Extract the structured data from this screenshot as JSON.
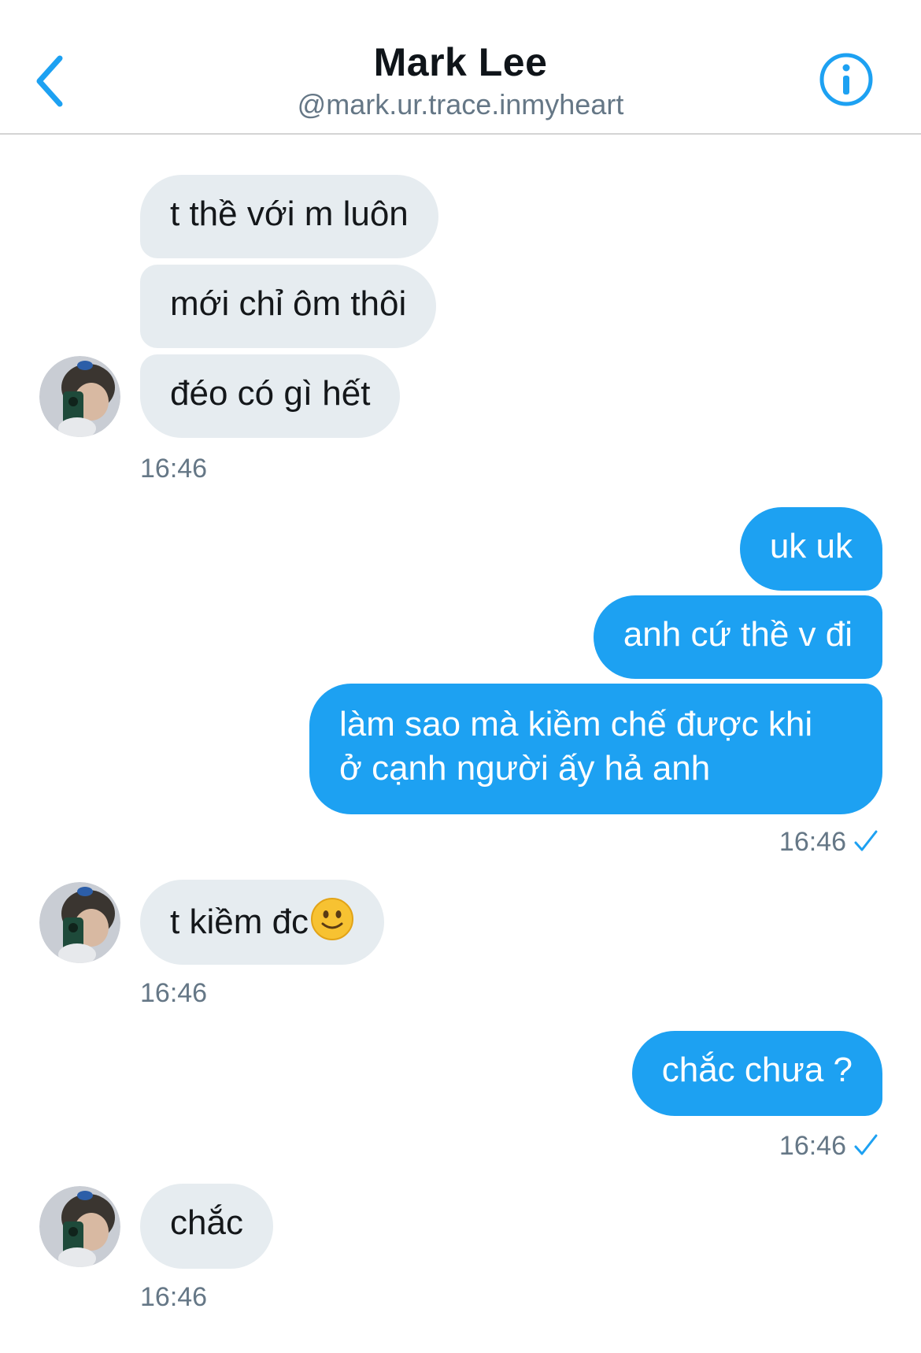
{
  "header": {
    "name": "Mark Lee",
    "handle": "@mark.ur.trace.inmyheart",
    "back_icon": "chevron-left-icon",
    "info_icon": "info-circle-icon",
    "accent_color": "#1da1f2"
  },
  "messages": [
    {
      "from": "them",
      "text": "t thề với m luôn"
    },
    {
      "from": "them",
      "text": "mới chỉ ôm thôi"
    },
    {
      "from": "them",
      "text": "đéo có gì hết",
      "time": "16:46"
    },
    {
      "from": "me",
      "text": "uk uk"
    },
    {
      "from": "me",
      "text": "anh cứ thề v đi"
    },
    {
      "from": "me",
      "line1": "làm sao mà kiềm chế được khi",
      "line2": "ở cạnh người ấy hả anh",
      "time": "16:46",
      "status_icon": "check-icon"
    },
    {
      "from": "them",
      "text": "t kiềm đc",
      "emoji": "🙂",
      "time": "16:46"
    },
    {
      "from": "me",
      "text": "chắc chưa ?",
      "time": "16:46",
      "status_icon": "check-icon"
    },
    {
      "from": "them",
      "text": "chắc",
      "time": "16:46"
    }
  ],
  "colors": {
    "incoming_bubble": "#e6ecf0",
    "outgoing_bubble": "#1da1f2",
    "timestamp": "#657786"
  }
}
